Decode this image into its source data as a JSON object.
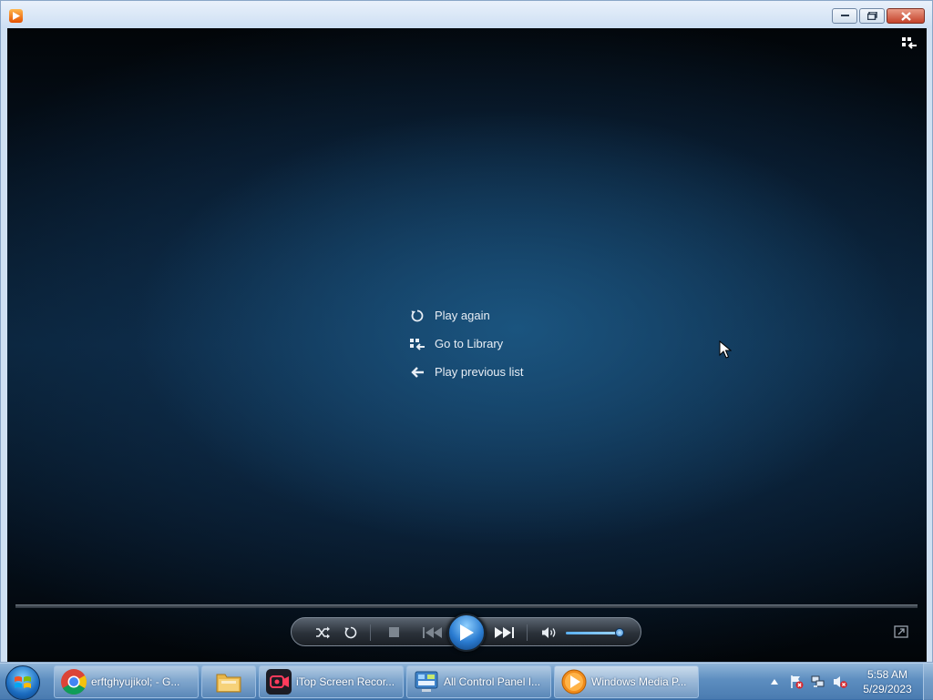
{
  "window": {
    "app_icon": "wmp-icon",
    "buttons": [
      "minimize-icon",
      "maximize-icon",
      "close-icon"
    ]
  },
  "player": {
    "switch_to_library_icon": "switch-to-library-icon",
    "menu": [
      {
        "icon": "replay-icon",
        "label": "Play again"
      },
      {
        "icon": "library-icon",
        "label": "Go to Library"
      },
      {
        "icon": "back-arrow-icon",
        "label": "Play previous list"
      }
    ],
    "controls": [
      "shuffle-icon",
      "repeat-icon",
      "stop-icon",
      "previous-icon",
      "play-icon",
      "next-icon",
      "volume-icon"
    ],
    "volume_level": 0.95
  },
  "taskbar": {
    "items": [
      {
        "icon": "chrome-icon",
        "label": "erftghyujikol; - G..."
      },
      {
        "icon": "folder-icon",
        "label": ""
      },
      {
        "icon": "screen-recorder-icon",
        "label": "iTop Screen Recor..."
      },
      {
        "icon": "control-panel-icon",
        "label": "All Control Panel I..."
      },
      {
        "icon": "wmp-icon",
        "label": "Windows Media P..."
      }
    ],
    "clock": {
      "time": "5:58 AM",
      "date": "5/29/2023"
    }
  }
}
